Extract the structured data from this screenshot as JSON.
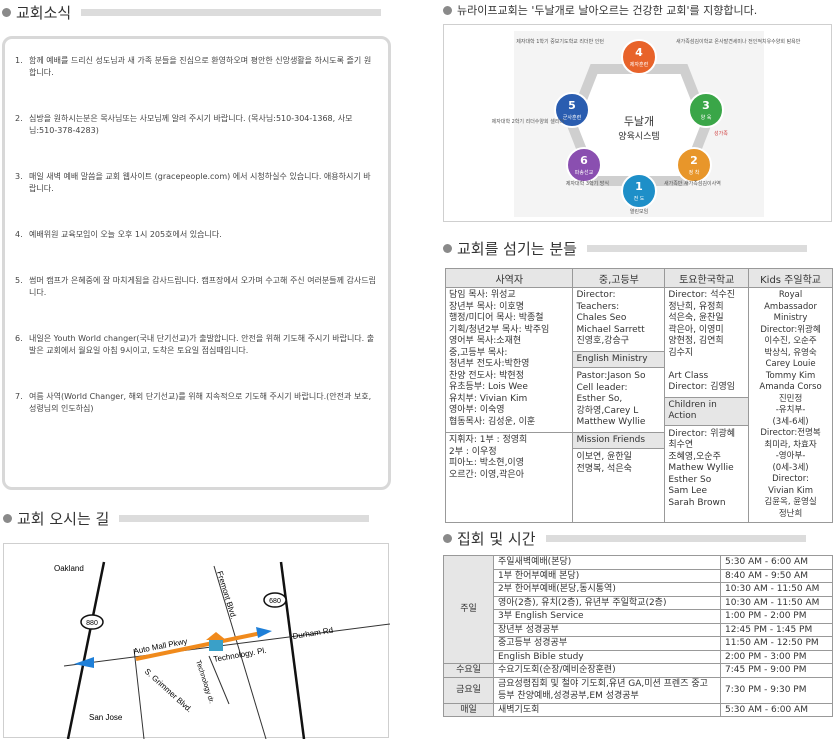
{
  "sections": {
    "news_title": "교회소식",
    "directions_title": "교회 오시는 길",
    "vision_line": "뉴라이프교회는 '두날개로 날아오르는 건강한 교회'를 지향합니다.",
    "staff_title": "교회를 섬기는 분들",
    "schedule_title": "집회 및 시간"
  },
  "notices": [
    {
      "num": "1.",
      "text": "함께 예배를 드리신 성도님과 새 가족 분들을 진심으로 환영하오며 평안한 신앙생활을 하시도록 즐기 원합니다."
    },
    {
      "num": "2.",
      "text": "심방을 원하시는분은 목사님또는 사모님께 알려 주시기 바랍니다. (목사님:510-304-1368, 사모님:510-378-4283)"
    },
    {
      "num": "3.",
      "text": "매일 새벽 예배 말씀을 교회 웹사이트 (gracepeople.com) 에서 시청하실수 있습니다. 애용하시기 바랍니다."
    },
    {
      "num": "4.",
      "text": "예배위원 교육모임이 오늘 오후 1시 205호에서 있습니다."
    },
    {
      "num": "5.",
      "text": "썸머 캠프가 은혜중에 잘 마치게됨을 감사드립니다. 캠프장에서 오가며 수고해 주신 여러분들께 감사드립니다."
    },
    {
      "num": "6.",
      "text": "내일은 Youth World changer(국내 단기선교)가 출발합니다. 안전을 위해 기도해 주시기 바랍니다. 출발은 교회에서 월요일 아침 9시이고, 도착은 토요일 점심때입니다."
    },
    {
      "num": "7.",
      "text": "여름 사역(World Changer, 해외 단기선교)를 위해 지속적으로 기도해 주시기 바랍니다.(안전과 보호, 성령님의 인도하심)"
    }
  ],
  "map": {
    "oakland": "Oakland",
    "san_jose": "San Jose",
    "hwy_880_left": "880",
    "hwy_880_right": "680",
    "auto_mall": "Auto Mall Pkwy",
    "fremont": "Fremont Blvd.",
    "durham": "Durham Rd",
    "grimmer": "S. Grimmer Blvd.",
    "technology_dr": "Technology dr.",
    "technology_pl": "Technology. Pl."
  },
  "vision": {
    "center_title": "두날개",
    "center_sub": "양육시스템",
    "nodes": [
      {
        "num": "1",
        "label": "전 도",
        "color": "#1e8fc8"
      },
      {
        "num": "2",
        "label": "정 착",
        "color": "#e8962a"
      },
      {
        "num": "3",
        "label": "양 육",
        "color": "#3aa648"
      },
      {
        "num": "4",
        "label": "제자훈련",
        "color": "#e8632a"
      },
      {
        "num": "5",
        "label": "군사훈련",
        "color": "#2a5db0"
      },
      {
        "num": "6",
        "label": "파송선교",
        "color": "#8a4fb0"
      }
    ],
    "notes": {
      "n4": "새가족섬김이학교 온사발견세미나 전인적치유수양회 탐욕반",
      "n4_left": "제자대학 1학기 중보기도학교 리더반 인턴",
      "n3_right": "성가족",
      "n1_bottom": "열린모임",
      "n1_right": "새가족반 새가족섬김이사역",
      "n5_left": "제자대학 2학기 리더수양회 셀리더",
      "n6_left": "제자대학 3학기 방식"
    }
  },
  "staff": {
    "headers": [
      "사역자",
      "중,고등부",
      "토요한국학교",
      "Kids 주일학교"
    ],
    "col1": [
      "담임 목사: 위성교",
      "장년부 목사: 이호명",
      "행정/미디어 목사: 박종철",
      "기획/청년2부 목사: 박주임",
      "영어부 목사:소재현",
      "중,고등부 목사:",
      "청년부 전도사:박한영",
      "찬양 전도사: 박현정",
      "유초등부: Lois Wee",
      "유치부: Vivian Kim",
      "영아부: 이숙영",
      "협동목사: 김성운, 이훈"
    ],
    "col1_b": [
      "지휘자: 1부 : 정영희",
      "2부 : 이우정",
      "피아노: 박소현,이영",
      "오르간: 이영,곽은아"
    ],
    "col2": [
      "Director:",
      "Teachers:",
      "Chales Seo",
      "Michael Sarrett",
      "진영호,강승구"
    ],
    "col2_em_head": "English Ministry",
    "col2_em": [
      "Pastor:Jason So",
      "Cell leader:",
      "Esther So,",
      "강하영,Carey L",
      "Matthew Wyllie"
    ],
    "col2_mf_head": "Mission Friends",
    "col2_mf": [
      "이보연, 윤한일",
      "전명복, 석은숙"
    ],
    "col3": [
      "Director: 석수진",
      "정난희, 유정희",
      "석은숙, 윤찬일",
      "곽은아, 이영미",
      "양현정, 김연희",
      "김수지",
      "",
      "Art Class",
      "Director: 김영임"
    ],
    "col3_ca_head": "Children in Action",
    "col3_ca": [
      "Director: 위광혜",
      "최수연",
      "조혜영,오순주",
      "Mathew Wyllie",
      "Esther So",
      "Sam Lee",
      "Sarah Brown"
    ],
    "col4": [
      "Royal Ambassador",
      "Ministry",
      "Director:위광혜",
      "이수진, 오순주",
      "박상식, 유영숙",
      "Carey Louie",
      "Tommy Kim",
      "Amanda Corso",
      "진민정",
      "-유치부-",
      "(3세-6세)",
      "Director:전명복",
      "최미라, 차효자",
      "-영아부-",
      "(0세-3세)",
      "Director:",
      "Vivian Kim",
      "김윤옥, 윤영실",
      "정난희"
    ]
  },
  "schedule": {
    "rows": [
      {
        "cat": "주일",
        "items": [
          [
            "주일새벽예배(본당)",
            "5:30 AM - 6:00 AM"
          ],
          [
            "1부 한어부예배 본당)",
            "8:40 AM - 9:50 AM"
          ],
          [
            "2부 한어부예배(본당,동시통역)",
            "10:30 AM - 11:50 AM"
          ],
          [
            "영아(2층), 유치(2층), 유년부 주일학교(2층)",
            "10:30 AM - 11:50 AM"
          ],
          [
            "3부 English Service",
            "1:00 PM - 2:00 PM"
          ],
          [
            "장년부 성경공부",
            "12:45 PM - 1:45 PM"
          ],
          [
            "중고등부 성경공부",
            "11:50 AM - 12:50 PM"
          ],
          [
            "English Bible study",
            "2:00 PM - 3:00 PM"
          ]
        ]
      },
      {
        "cat": "수요일",
        "items": [
          [
            "수요기도회(순장/예비순장훈련)",
            "7:45 PM - 9:00 PM"
          ]
        ]
      },
      {
        "cat": "금요일",
        "items": [
          [
            "금요성령집회 및 철야 기도회,유년 GA,미션 프렌즈 중고등부 찬양예배,성경공부,EM 성경공부",
            "7:30 PM - 9:30 PM"
          ]
        ]
      },
      {
        "cat": "매일",
        "items": [
          [
            "새벽기도회",
            "5:30 AM - 6:00 AM"
          ]
        ]
      }
    ]
  }
}
